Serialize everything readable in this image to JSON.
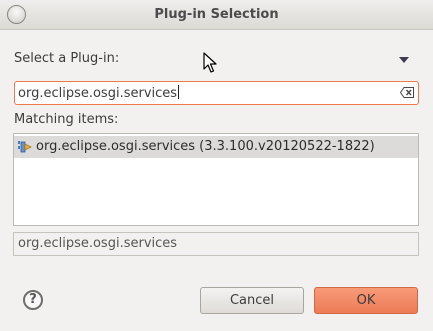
{
  "window": {
    "title": "Plug-in Selection"
  },
  "prompt": {
    "label": "Select a Plug-in:"
  },
  "search": {
    "value": "org.eclipse.osgi.services"
  },
  "matching": {
    "label": "Matching items:",
    "items": [
      {
        "label": "org.eclipse.osgi.services (3.3.100.v20120522-1822)",
        "icon": "plugin-icon",
        "selected": true
      }
    ]
  },
  "status": {
    "text": "org.eclipse.osgi.services"
  },
  "buttons": {
    "cancel": "Cancel",
    "ok": "OK",
    "help": "?"
  },
  "colors": {
    "accent": "#f07746",
    "ok_button": "#f28a63",
    "selection": "#dcdbd9"
  }
}
